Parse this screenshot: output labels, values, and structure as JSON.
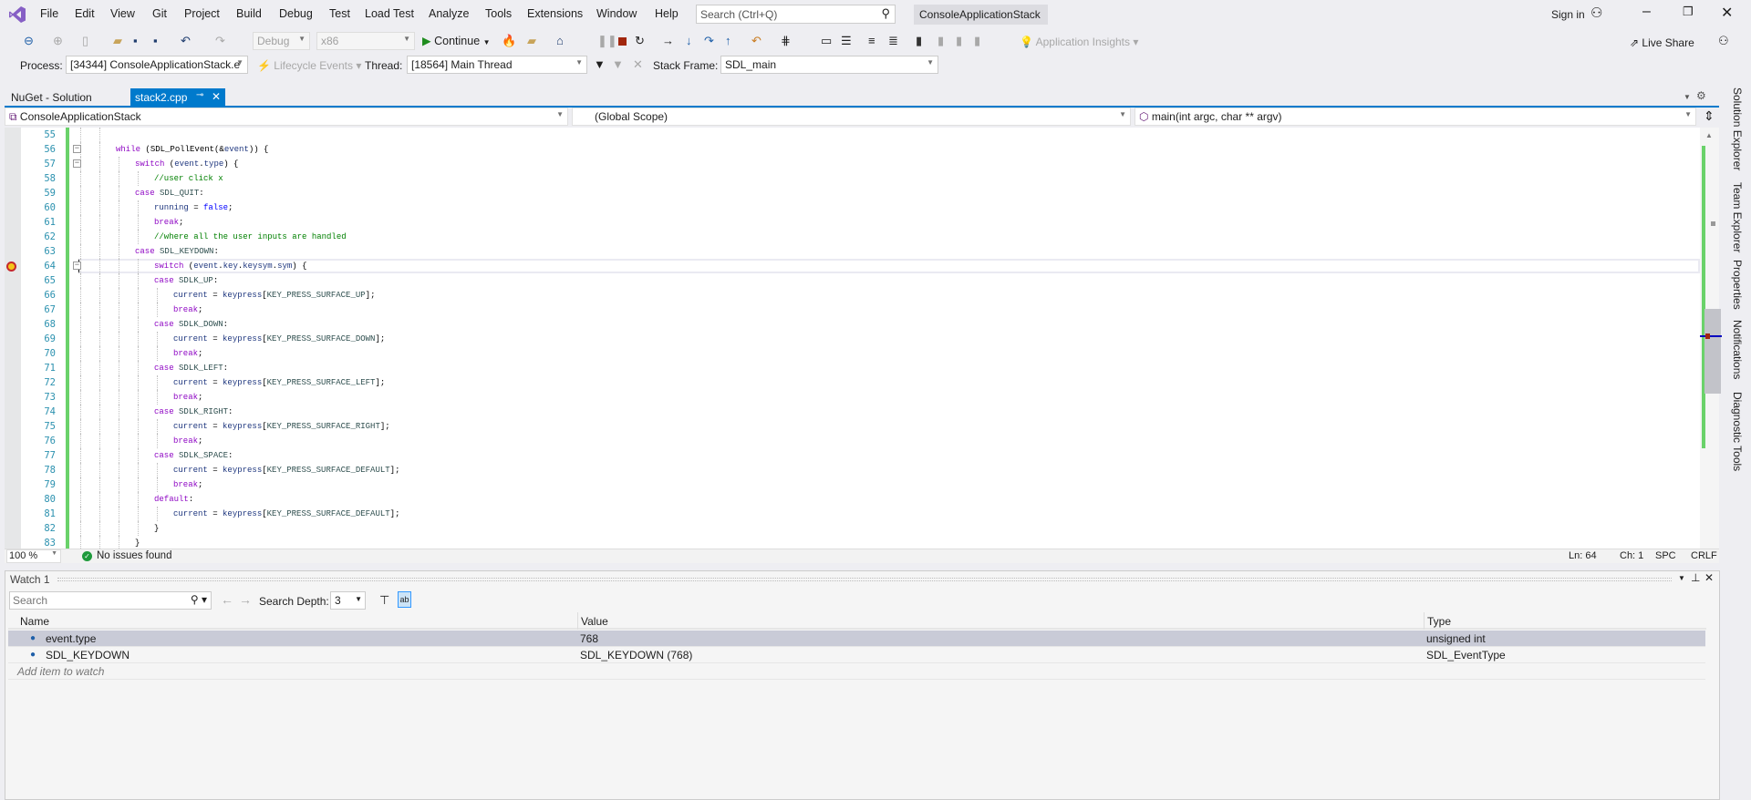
{
  "menu": {
    "items": [
      "File",
      "Edit",
      "View",
      "Git",
      "Project",
      "Build",
      "Debug",
      "Test",
      "Load Test",
      "Analyze",
      "Tools",
      "Extensions",
      "Window",
      "Help"
    ],
    "search_placeholder": "Search (Ctrl+Q)",
    "solution_title": "ConsoleApplicationStack",
    "sign_in": "Sign in"
  },
  "toolbar": {
    "config": "Debug",
    "platform": "x86",
    "continue": "Continue",
    "app_insights": "Application Insights",
    "live_share": "Live Share"
  },
  "debug_location": {
    "process_label": "Process:",
    "process": "[34344] ConsoleApplicationStack.e",
    "lifecycle": "Lifecycle Events",
    "thread_label": "Thread:",
    "thread": "[18564] Main Thread",
    "stack_label": "Stack Frame:",
    "stack": "SDL_main"
  },
  "tabs": {
    "nuget": "NuGet - Solution",
    "active": "stack2.cpp"
  },
  "navbar": {
    "project": "ConsoleApplicationStack",
    "scope": "(Global Scope)",
    "member": "main(int argc, char ** argv)"
  },
  "editor": {
    "current_line": 64,
    "lines": [
      {
        "n": 55,
        "i": 2,
        "t": []
      },
      {
        "n": 56,
        "i": 2,
        "fold": true,
        "t": [
          [
            "k",
            "while"
          ],
          [
            "p",
            " (SDL_PollEvent(&"
          ],
          [
            "v",
            "event"
          ],
          [
            "p",
            ")) {"
          ]
        ]
      },
      {
        "n": 57,
        "i": 3,
        "fold": true,
        "t": [
          [
            "k",
            "switch"
          ],
          [
            "p",
            " ("
          ],
          [
            "v",
            "event"
          ],
          [
            "p",
            "."
          ],
          [
            "v",
            "type"
          ],
          [
            "p",
            ") {"
          ]
        ]
      },
      {
        "n": 58,
        "i": 4,
        "t": [
          [
            "c",
            "//user click x"
          ]
        ]
      },
      {
        "n": 59,
        "i": 3,
        "t": [
          [
            "k",
            "case"
          ],
          [
            "p",
            " "
          ],
          [
            "e",
            "SDL_QUIT"
          ],
          [
            "p",
            ":"
          ]
        ]
      },
      {
        "n": 60,
        "i": 4,
        "t": [
          [
            "v",
            "running"
          ],
          [
            "p",
            " = "
          ],
          [
            "b",
            "false"
          ],
          [
            "p",
            ";"
          ]
        ]
      },
      {
        "n": 61,
        "i": 4,
        "t": [
          [
            "k",
            "break"
          ],
          [
            "p",
            ";"
          ]
        ]
      },
      {
        "n": 62,
        "i": 4,
        "t": [
          [
            "c",
            "//where all the user inputs are handled"
          ]
        ]
      },
      {
        "n": 63,
        "i": 3,
        "t": [
          [
            "k",
            "case"
          ],
          [
            "p",
            " "
          ],
          [
            "e",
            "SDL_KEYDOWN"
          ],
          [
            "p",
            ":"
          ]
        ]
      },
      {
        "n": 64,
        "i": 4,
        "fold": true,
        "t": [
          [
            "k",
            "switch"
          ],
          [
            "p",
            " ("
          ],
          [
            "v",
            "event"
          ],
          [
            "p",
            "."
          ],
          [
            "v",
            "key"
          ],
          [
            "p",
            "."
          ],
          [
            "v",
            "keysym"
          ],
          [
            "p",
            "."
          ],
          [
            "v",
            "sym"
          ],
          [
            "p",
            ") {"
          ]
        ]
      },
      {
        "n": 65,
        "i": 4,
        "t": [
          [
            "k",
            "case"
          ],
          [
            "p",
            " "
          ],
          [
            "e",
            "SDLK_UP"
          ],
          [
            "p",
            ":"
          ]
        ]
      },
      {
        "n": 66,
        "i": 5,
        "t": [
          [
            "v",
            "current"
          ],
          [
            "p",
            " = "
          ],
          [
            "v",
            "keypress"
          ],
          [
            "p",
            "["
          ],
          [
            "e",
            "KEY_PRESS_SURFACE_UP"
          ],
          [
            "p",
            "];"
          ]
        ]
      },
      {
        "n": 67,
        "i": 5,
        "t": [
          [
            "k",
            "break"
          ],
          [
            "p",
            ";"
          ]
        ]
      },
      {
        "n": 68,
        "i": 4,
        "t": [
          [
            "k",
            "case"
          ],
          [
            "p",
            " "
          ],
          [
            "e",
            "SDLK_DOWN"
          ],
          [
            "p",
            ":"
          ]
        ]
      },
      {
        "n": 69,
        "i": 5,
        "t": [
          [
            "v",
            "current"
          ],
          [
            "p",
            " = "
          ],
          [
            "v",
            "keypress"
          ],
          [
            "p",
            "["
          ],
          [
            "e",
            "KEY_PRESS_SURFACE_DOWN"
          ],
          [
            "p",
            "];"
          ]
        ]
      },
      {
        "n": 70,
        "i": 5,
        "t": [
          [
            "k",
            "break"
          ],
          [
            "p",
            ";"
          ]
        ]
      },
      {
        "n": 71,
        "i": 4,
        "t": [
          [
            "k",
            "case"
          ],
          [
            "p",
            " "
          ],
          [
            "e",
            "SDLK_LEFT"
          ],
          [
            "p",
            ":"
          ]
        ]
      },
      {
        "n": 72,
        "i": 5,
        "t": [
          [
            "v",
            "current"
          ],
          [
            "p",
            " = "
          ],
          [
            "v",
            "keypress"
          ],
          [
            "p",
            "["
          ],
          [
            "e",
            "KEY_PRESS_SURFACE_LEFT"
          ],
          [
            "p",
            "];"
          ]
        ]
      },
      {
        "n": 73,
        "i": 5,
        "t": [
          [
            "k",
            "break"
          ],
          [
            "p",
            ";"
          ]
        ]
      },
      {
        "n": 74,
        "i": 4,
        "t": [
          [
            "k",
            "case"
          ],
          [
            "p",
            " "
          ],
          [
            "e",
            "SDLK_RIGHT"
          ],
          [
            "p",
            ":"
          ]
        ]
      },
      {
        "n": 75,
        "i": 5,
        "t": [
          [
            "v",
            "current"
          ],
          [
            "p",
            " = "
          ],
          [
            "v",
            "keypress"
          ],
          [
            "p",
            "["
          ],
          [
            "e",
            "KEY_PRESS_SURFACE_RIGHT"
          ],
          [
            "p",
            "];"
          ]
        ]
      },
      {
        "n": 76,
        "i": 5,
        "t": [
          [
            "k",
            "break"
          ],
          [
            "p",
            ";"
          ]
        ]
      },
      {
        "n": 77,
        "i": 4,
        "t": [
          [
            "k",
            "case"
          ],
          [
            "p",
            " "
          ],
          [
            "e",
            "SDLK_SPACE"
          ],
          [
            "p",
            ":"
          ]
        ]
      },
      {
        "n": 78,
        "i": 5,
        "t": [
          [
            "v",
            "current"
          ],
          [
            "p",
            " = "
          ],
          [
            "v",
            "keypress"
          ],
          [
            "p",
            "["
          ],
          [
            "e",
            "KEY_PRESS_SURFACE_DEFAULT"
          ],
          [
            "p",
            "];"
          ]
        ]
      },
      {
        "n": 79,
        "i": 5,
        "t": [
          [
            "k",
            "break"
          ],
          [
            "p",
            ";"
          ]
        ]
      },
      {
        "n": 80,
        "i": 4,
        "t": [
          [
            "k",
            "default"
          ],
          [
            "p",
            ":"
          ]
        ]
      },
      {
        "n": 81,
        "i": 5,
        "t": [
          [
            "v",
            "current"
          ],
          [
            "p",
            " = "
          ],
          [
            "v",
            "keypress"
          ],
          [
            "p",
            "["
          ],
          [
            "e",
            "KEY_PRESS_SURFACE_DEFAULT"
          ],
          [
            "p",
            "];"
          ]
        ]
      },
      {
        "n": 82,
        "i": 4,
        "t": [
          [
            "p",
            "}"
          ]
        ]
      },
      {
        "n": 83,
        "i": 3,
        "t": [
          [
            "p",
            "}"
          ]
        ]
      }
    ]
  },
  "status": {
    "zoom": "100 %",
    "issues": "No issues found",
    "ln": "Ln: 64",
    "ch": "Ch: 1",
    "spc": "SPC",
    "crlf": "CRLF"
  },
  "side_tabs": [
    "Solution Explorer",
    "Team Explorer",
    "Properties",
    "Notifications",
    "Diagnostic Tools"
  ],
  "watch": {
    "title": "Watch 1",
    "search_placeholder": "Search",
    "depth_label": "Search Depth:",
    "depth": "3",
    "columns": [
      "Name",
      "Value",
      "Type"
    ],
    "rows": [
      {
        "name": "event.type",
        "value": "768",
        "type": "unsigned int"
      },
      {
        "name": "SDL_KEYDOWN",
        "value": "SDL_KEYDOWN (768)",
        "type": "SDL_EventType"
      }
    ],
    "add_item": "Add item to watch"
  },
  "colors": {
    "accent": "#007acc",
    "logo": "#68217a",
    "change_bar": "#6ad26a",
    "selected_row": "#c9cbd7"
  }
}
